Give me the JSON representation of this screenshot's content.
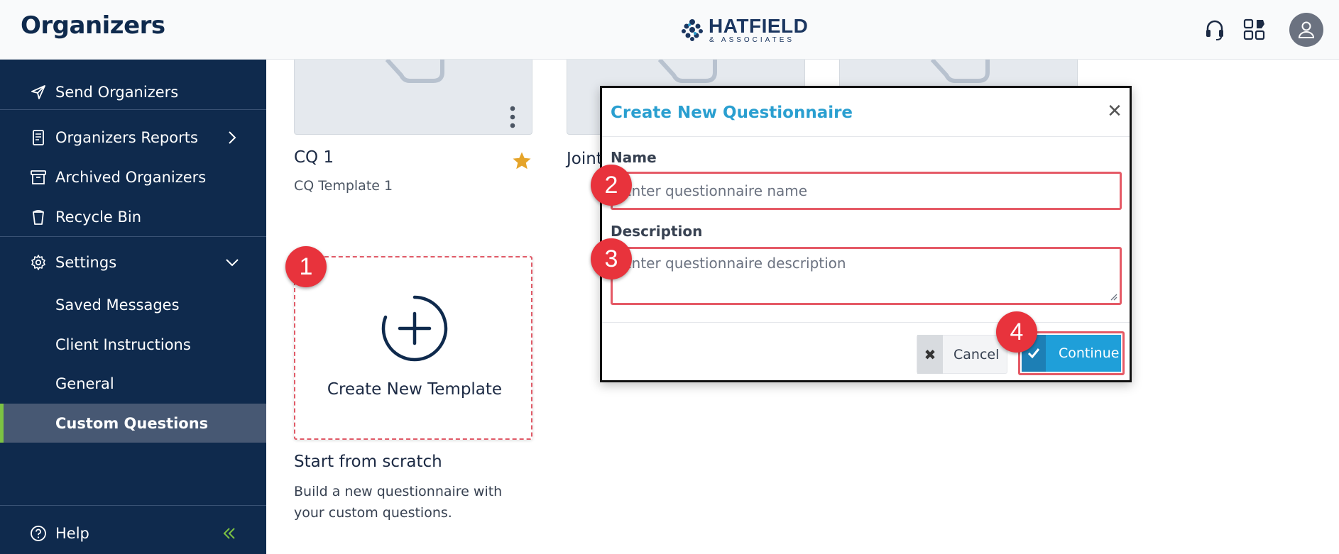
{
  "header": {
    "title": "Organizers",
    "logo_name": "HATFIELD",
    "logo_sub": "& ASSOCIATES"
  },
  "sidebar": {
    "items": [
      {
        "label": "Send Organizers",
        "icon": "send-icon"
      },
      {
        "label": "Organizers Reports",
        "icon": "report-icon"
      },
      {
        "label": "Archived Organizers",
        "icon": "archive-icon"
      },
      {
        "label": "Recycle Bin",
        "icon": "trash-icon"
      },
      {
        "label": "Settings",
        "icon": "gear-icon"
      }
    ],
    "settings_sub": [
      "Saved Messages",
      "Client Instructions",
      "General",
      "Custom Questions"
    ],
    "active": "Custom Questions",
    "help_label": "Help"
  },
  "templates": [
    {
      "title": "CQ 1",
      "subtitle": "CQ Template 1",
      "favorite": true
    },
    {
      "title": "Joint",
      "subtitle": ""
    }
  ],
  "create_card": {
    "label": "Create New Template",
    "title": "Start from scratch",
    "description": "Build a new questionnaire with your custom questions."
  },
  "modal": {
    "title": "Create New Questionnaire",
    "name_label": "Name",
    "name_placeholder": "Enter questionnaire name",
    "description_label": "Description",
    "description_placeholder": "Enter questionnaire description",
    "cancel_label": "Cancel",
    "continue_label": "Continue"
  },
  "badges": [
    "1",
    "2",
    "3",
    "4"
  ],
  "colors": {
    "sidebar_bg": "#0f2a4d",
    "active_item_bg": "#475873",
    "active_accent": "#7cc243",
    "modal_title": "#2a9fd0",
    "primary_button": "#1f9fd9",
    "highlight": "#e55a66",
    "badge": "#e8333c",
    "star": "#e5a42a"
  }
}
